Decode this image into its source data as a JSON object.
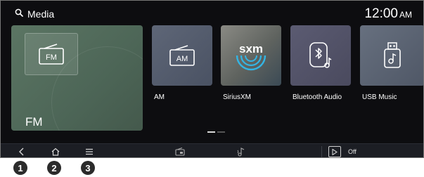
{
  "header": {
    "title": "Media",
    "time": "12:00",
    "ampm": "AM"
  },
  "tiles": {
    "fm": {
      "label": "FM",
      "icon_text": "FM",
      "icon": "radio-fm-icon",
      "selected": true
    },
    "am": {
      "label": "AM",
      "icon_text": "AM",
      "icon": "radio-am-icon"
    },
    "siriusxm": {
      "label": "SiriusXM",
      "icon_text": "sxm",
      "icon": "siriusxm-icon"
    },
    "bluetooth": {
      "label": "Bluetooth Audio",
      "icon": "bluetooth-audio-icon"
    },
    "usb": {
      "label": "USB Music",
      "icon": "usb-music-icon"
    }
  },
  "pager": {
    "pages": 2,
    "current": 1
  },
  "bottom_bar": {
    "back_icon": "back-arrow-icon",
    "home_icon": "home-icon",
    "menu_icon": "menu-icon",
    "radio_icon": "radio-icon",
    "music_icon": "music-note-icon",
    "play_icon": "play-icon",
    "status": "Off"
  },
  "callouts": {
    "one": "1",
    "two": "2",
    "three": "3"
  },
  "colors": {
    "screen_bg": "#0d0d10",
    "fm_tile": "#566f5f",
    "bar_bg": "#1c1e24",
    "callout_bg": "#2b2b2b"
  }
}
